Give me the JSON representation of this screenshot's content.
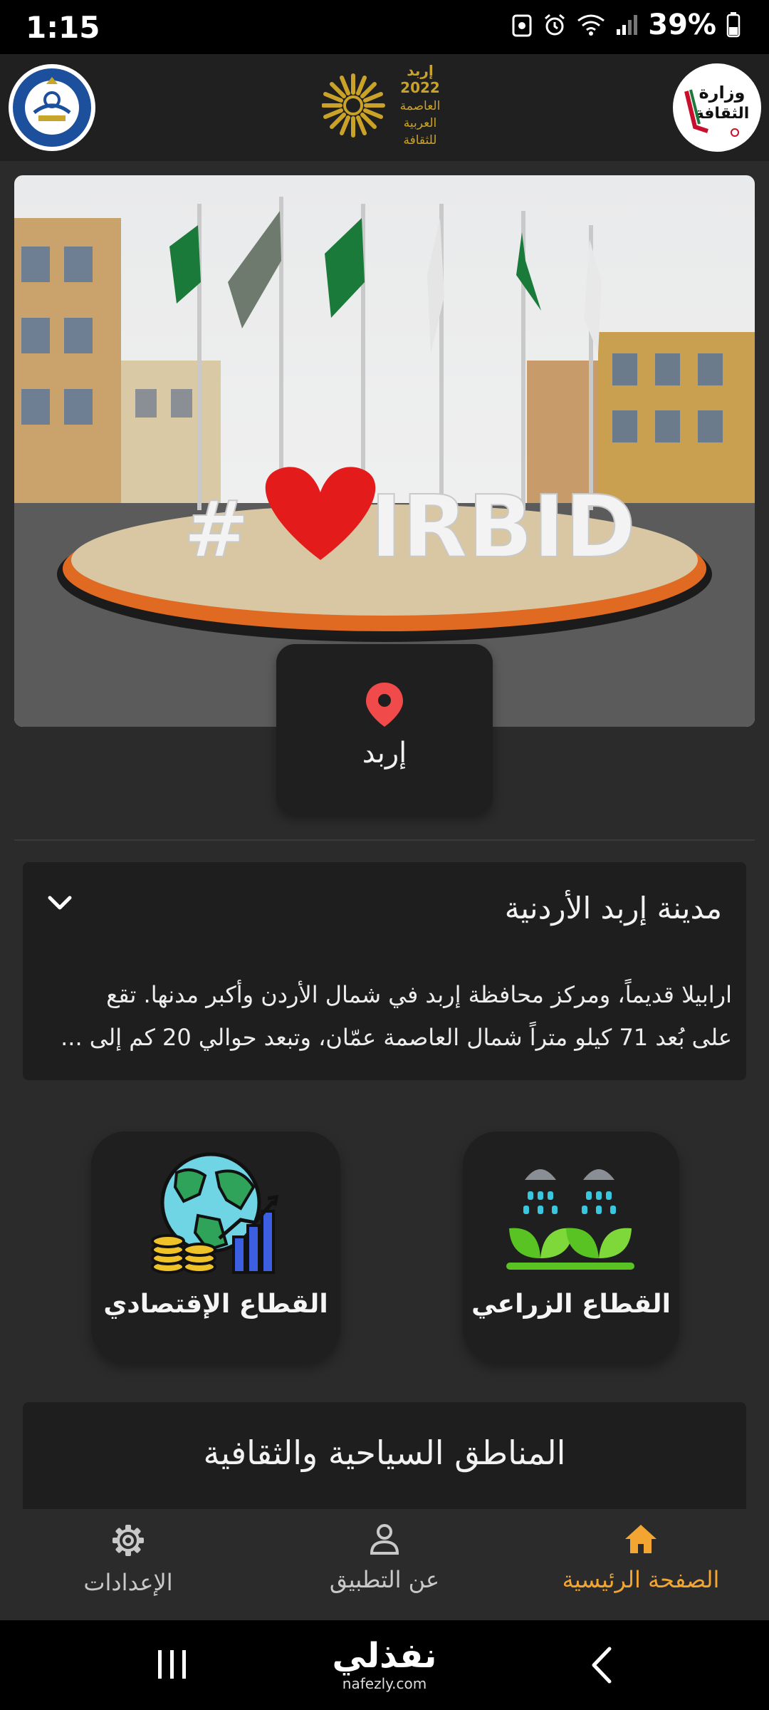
{
  "status_bar": {
    "time": "1:15",
    "battery_percent": "39%"
  },
  "header": {
    "center_logo_text": [
      "إربد",
      "2022",
      "العاصمة",
      "العربية",
      "للثقافة"
    ],
    "right_logo_text": [
      "وزارة",
      "الثقافة"
    ]
  },
  "hero": {
    "sign_text": "#IRBID"
  },
  "location": {
    "label": "إربد"
  },
  "about": {
    "title": "مدينة إربد الأردنية",
    "line1": "ارابيلا قديماً، ومركز محافظة إربد في شمال الأردن وأكبر مدنها. تقع",
    "line2": "على بُعد 71 كيلو متراً شمال العاصمة عمّان، وتبعد حوالي 20 كم إلى ..."
  },
  "sectors": {
    "economic": "القطاع الإقتصادي",
    "agricultural": "القطاع الزراعي"
  },
  "tourism": {
    "title": "المناطق السياحية والثقافية"
  },
  "bottom_nav": {
    "home": "الصفحة الرئيسية",
    "about_app": "عن التطبيق",
    "settings": "الإعدادات"
  },
  "watermark": {
    "main": "نفذلي",
    "sub": "nafezly.com"
  },
  "colors": {
    "accent": "#f2a531",
    "pin": "#f04a4a",
    "background": "#2b2b2c",
    "card": "#1e1e1f"
  }
}
